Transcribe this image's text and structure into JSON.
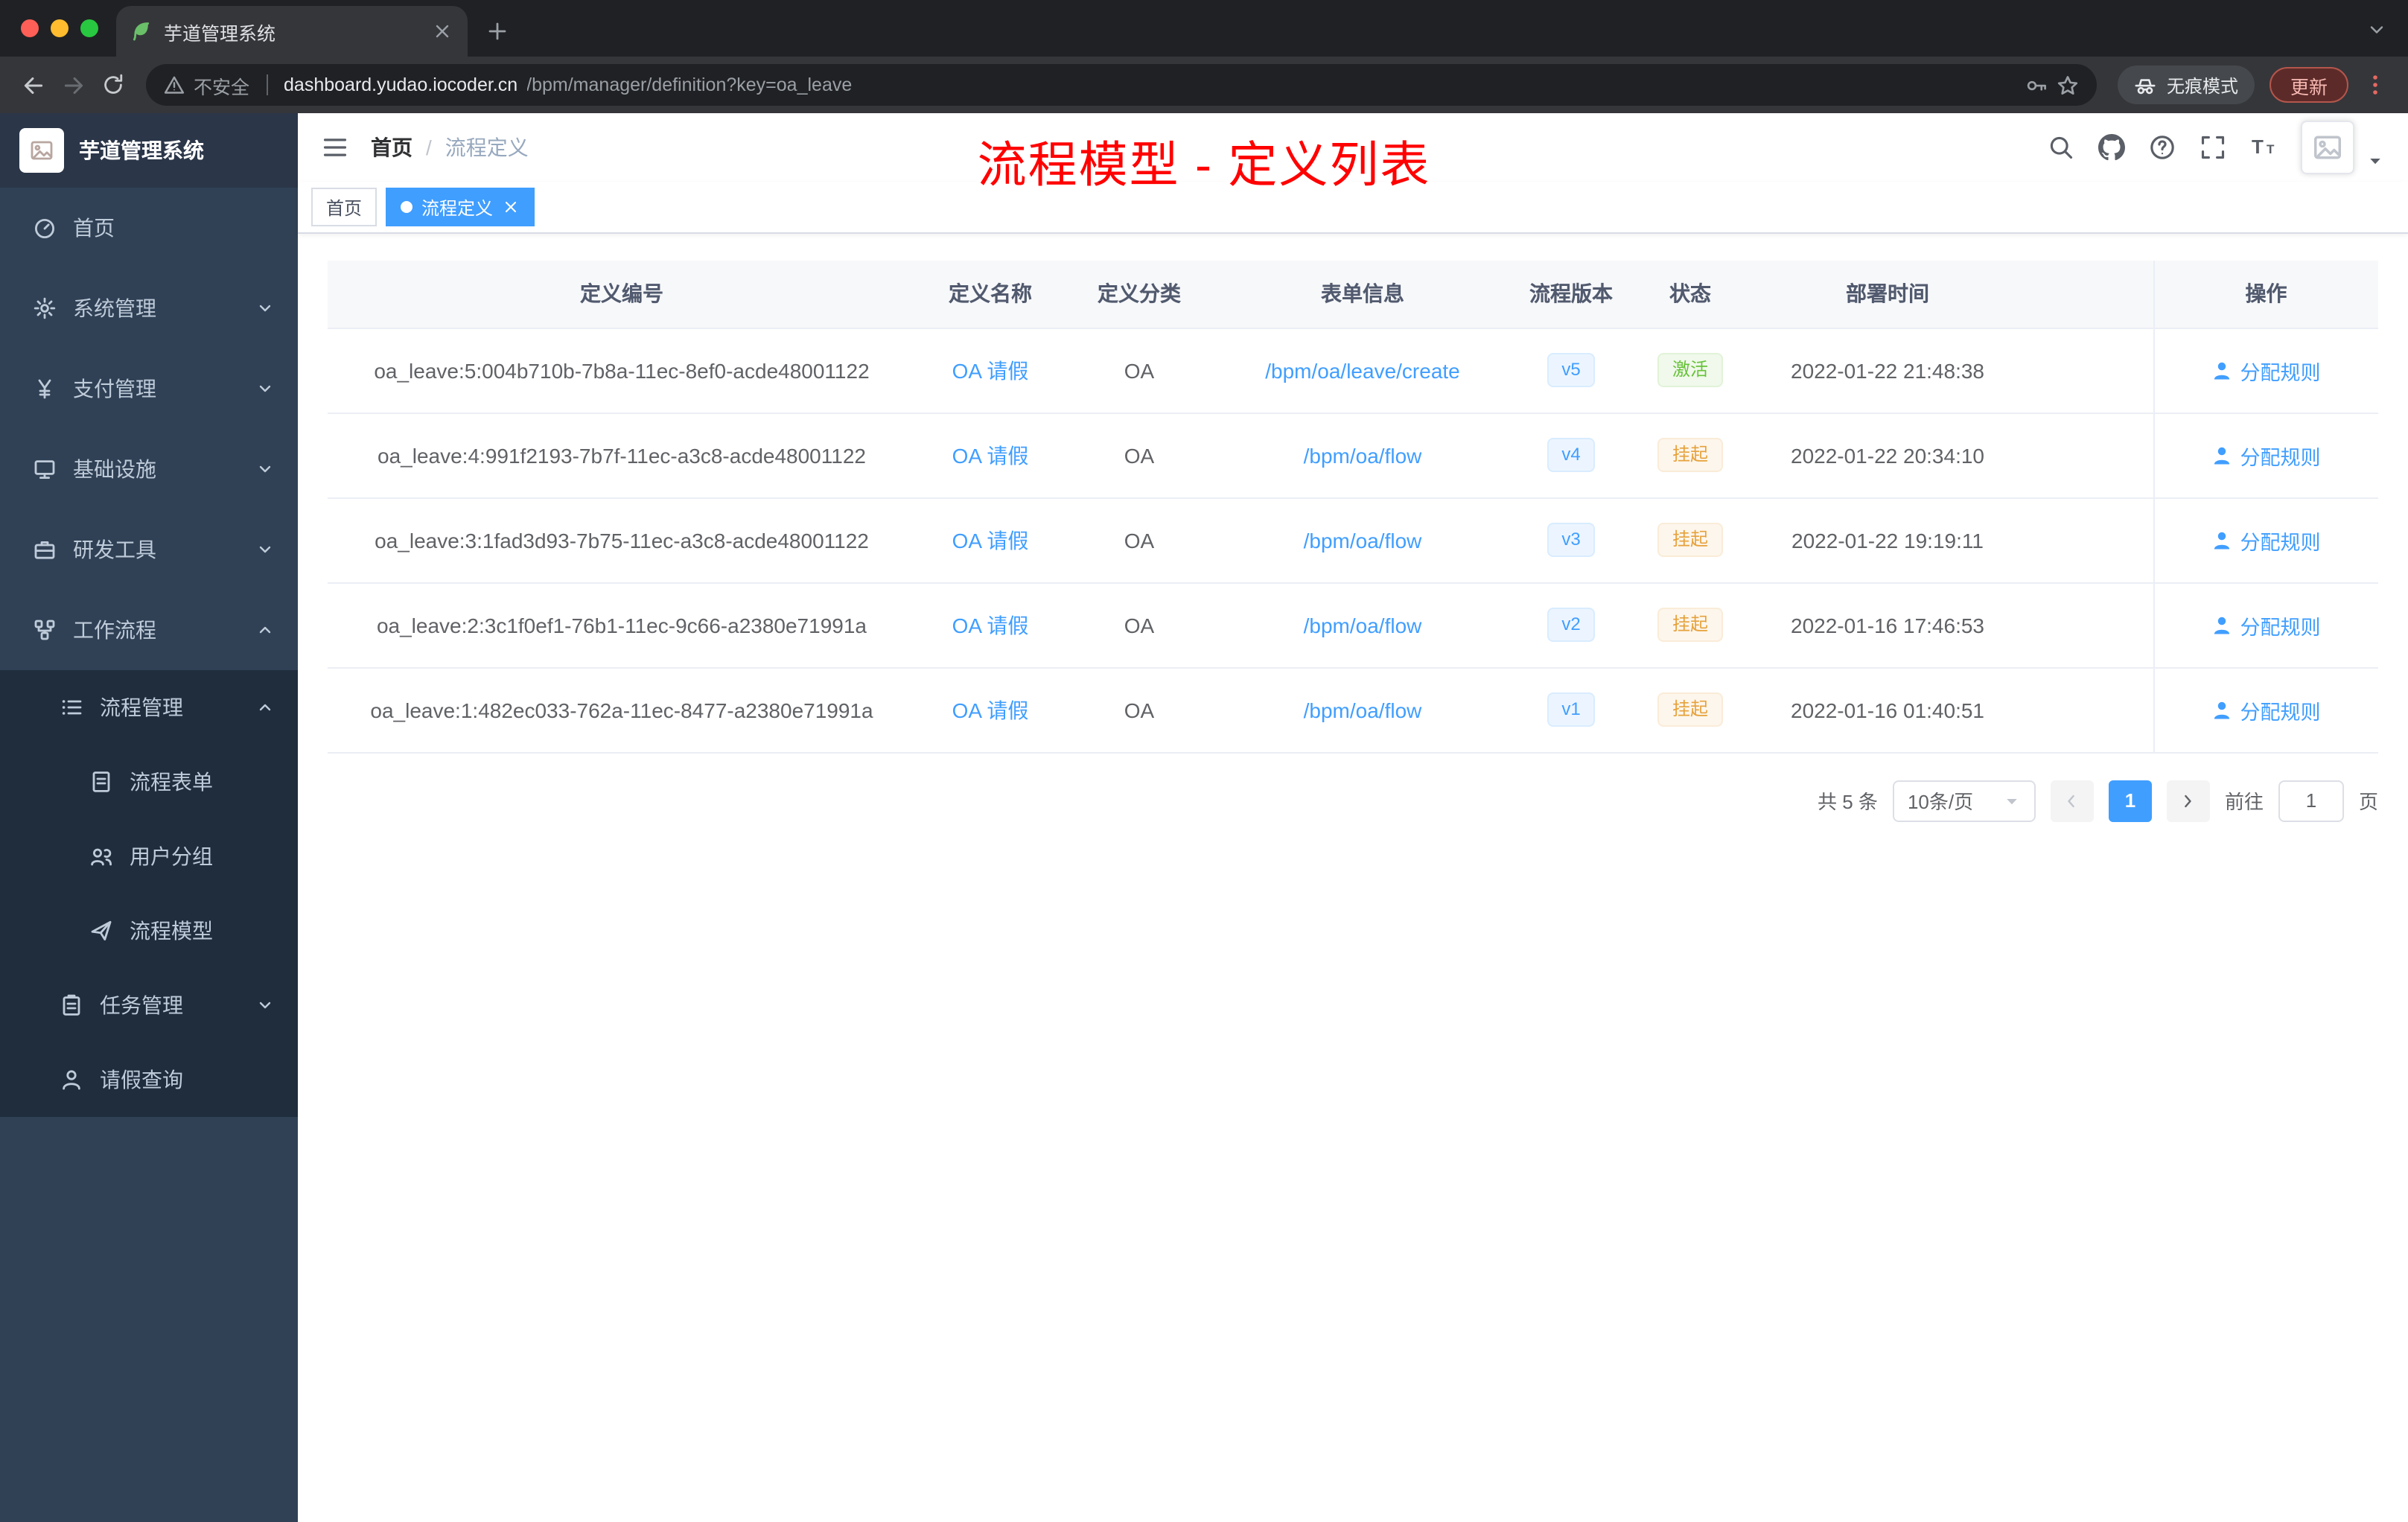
{
  "browser": {
    "tab_title": "芋道管理系统",
    "security_label": "不安全",
    "url_host": "dashboard.yudao.iocoder.cn",
    "url_path": "/bpm/manager/definition?key=oa_leave",
    "incognito_label": "无痕模式",
    "update_label": "更新"
  },
  "sidebar": {
    "logo_title": "芋道管理系统",
    "items": [
      {
        "label": "首页",
        "icon": "dashboard-icon",
        "level": 0
      },
      {
        "label": "系统管理",
        "icon": "gear-icon",
        "level": 0,
        "arrow": "down"
      },
      {
        "label": "支付管理",
        "icon": "yen-icon",
        "level": 0,
        "arrow": "down"
      },
      {
        "label": "基础设施",
        "icon": "monitor-icon",
        "level": 0,
        "arrow": "down"
      },
      {
        "label": "研发工具",
        "icon": "toolbox-icon",
        "level": 0,
        "arrow": "down"
      },
      {
        "label": "工作流程",
        "icon": "workflow-icon",
        "level": 0,
        "arrow": "up"
      },
      {
        "label": "流程管理",
        "icon": "process-list-icon",
        "level": 1,
        "arrow": "up",
        "dark": true
      },
      {
        "label": "流程表单",
        "icon": "form-icon",
        "level": 2,
        "dark": true
      },
      {
        "label": "用户分组",
        "icon": "user-group-icon",
        "level": 2,
        "dark": true
      },
      {
        "label": "流程模型",
        "icon": "paper-plane-icon",
        "level": 2,
        "dark": true
      },
      {
        "label": "任务管理",
        "icon": "task-icon",
        "level": 1,
        "arrow": "down",
        "dark": true
      },
      {
        "label": "请假查询",
        "icon": "person-icon",
        "level": 1,
        "dark": true
      }
    ]
  },
  "header": {
    "breadcrumb": [
      "首页",
      "流程定义"
    ],
    "breadcrumb_separator": "/",
    "annotation": "流程模型 - 定义列表"
  },
  "tags": [
    {
      "label": "首页",
      "active": false
    },
    {
      "label": "流程定义",
      "active": true
    }
  ],
  "table": {
    "columns": [
      "定义编号",
      "定义名称",
      "定义分类",
      "表单信息",
      "流程版本",
      "状态",
      "部署时间",
      "操作"
    ],
    "rows": [
      {
        "id": "oa_leave:5:004b710b-7b8a-11ec-8ef0-acde48001122",
        "name": "OA 请假",
        "category": "OA",
        "form": "/bpm/oa/leave/create",
        "version": "v5",
        "status": "激活",
        "status_type": "success",
        "deploy_time": "2022-01-22 21:48:38",
        "action": "分配规则"
      },
      {
        "id": "oa_leave:4:991f2193-7b7f-11ec-a3c8-acde48001122",
        "name": "OA 请假",
        "category": "OA",
        "form": "/bpm/oa/flow",
        "version": "v4",
        "status": "挂起",
        "status_type": "warning",
        "deploy_time": "2022-01-22 20:34:10",
        "action": "分配规则"
      },
      {
        "id": "oa_leave:3:1fad3d93-7b75-11ec-a3c8-acde48001122",
        "name": "OA 请假",
        "category": "OA",
        "form": "/bpm/oa/flow",
        "version": "v3",
        "status": "挂起",
        "status_type": "warning",
        "deploy_time": "2022-01-22 19:19:11",
        "action": "分配规则"
      },
      {
        "id": "oa_leave:2:3c1f0ef1-76b1-11ec-9c66-a2380e71991a",
        "name": "OA 请假",
        "category": "OA",
        "form": "/bpm/oa/flow",
        "version": "v2",
        "status": "挂起",
        "status_type": "warning",
        "deploy_time": "2022-01-16 17:46:53",
        "action": "分配规则"
      },
      {
        "id": "oa_leave:1:482ec033-762a-11ec-8477-a2380e71991a",
        "name": "OA 请假",
        "category": "OA",
        "form": "/bpm/oa/flow",
        "version": "v1",
        "status": "挂起",
        "status_type": "warning",
        "deploy_time": "2022-01-16 01:40:51",
        "action": "分配规则"
      }
    ]
  },
  "pagination": {
    "total": "共 5 条",
    "page_size": "10条/页",
    "current": "1",
    "goto_label": "前往",
    "goto_value": "1",
    "page_unit": "页"
  },
  "colors": {
    "accent": "#409eff",
    "success": "#67c23a",
    "warning": "#e6a23c",
    "sidebar_bg": "#304156",
    "sidebar_sub_bg": "#1f2d3d",
    "annotation": "#ff0000"
  }
}
